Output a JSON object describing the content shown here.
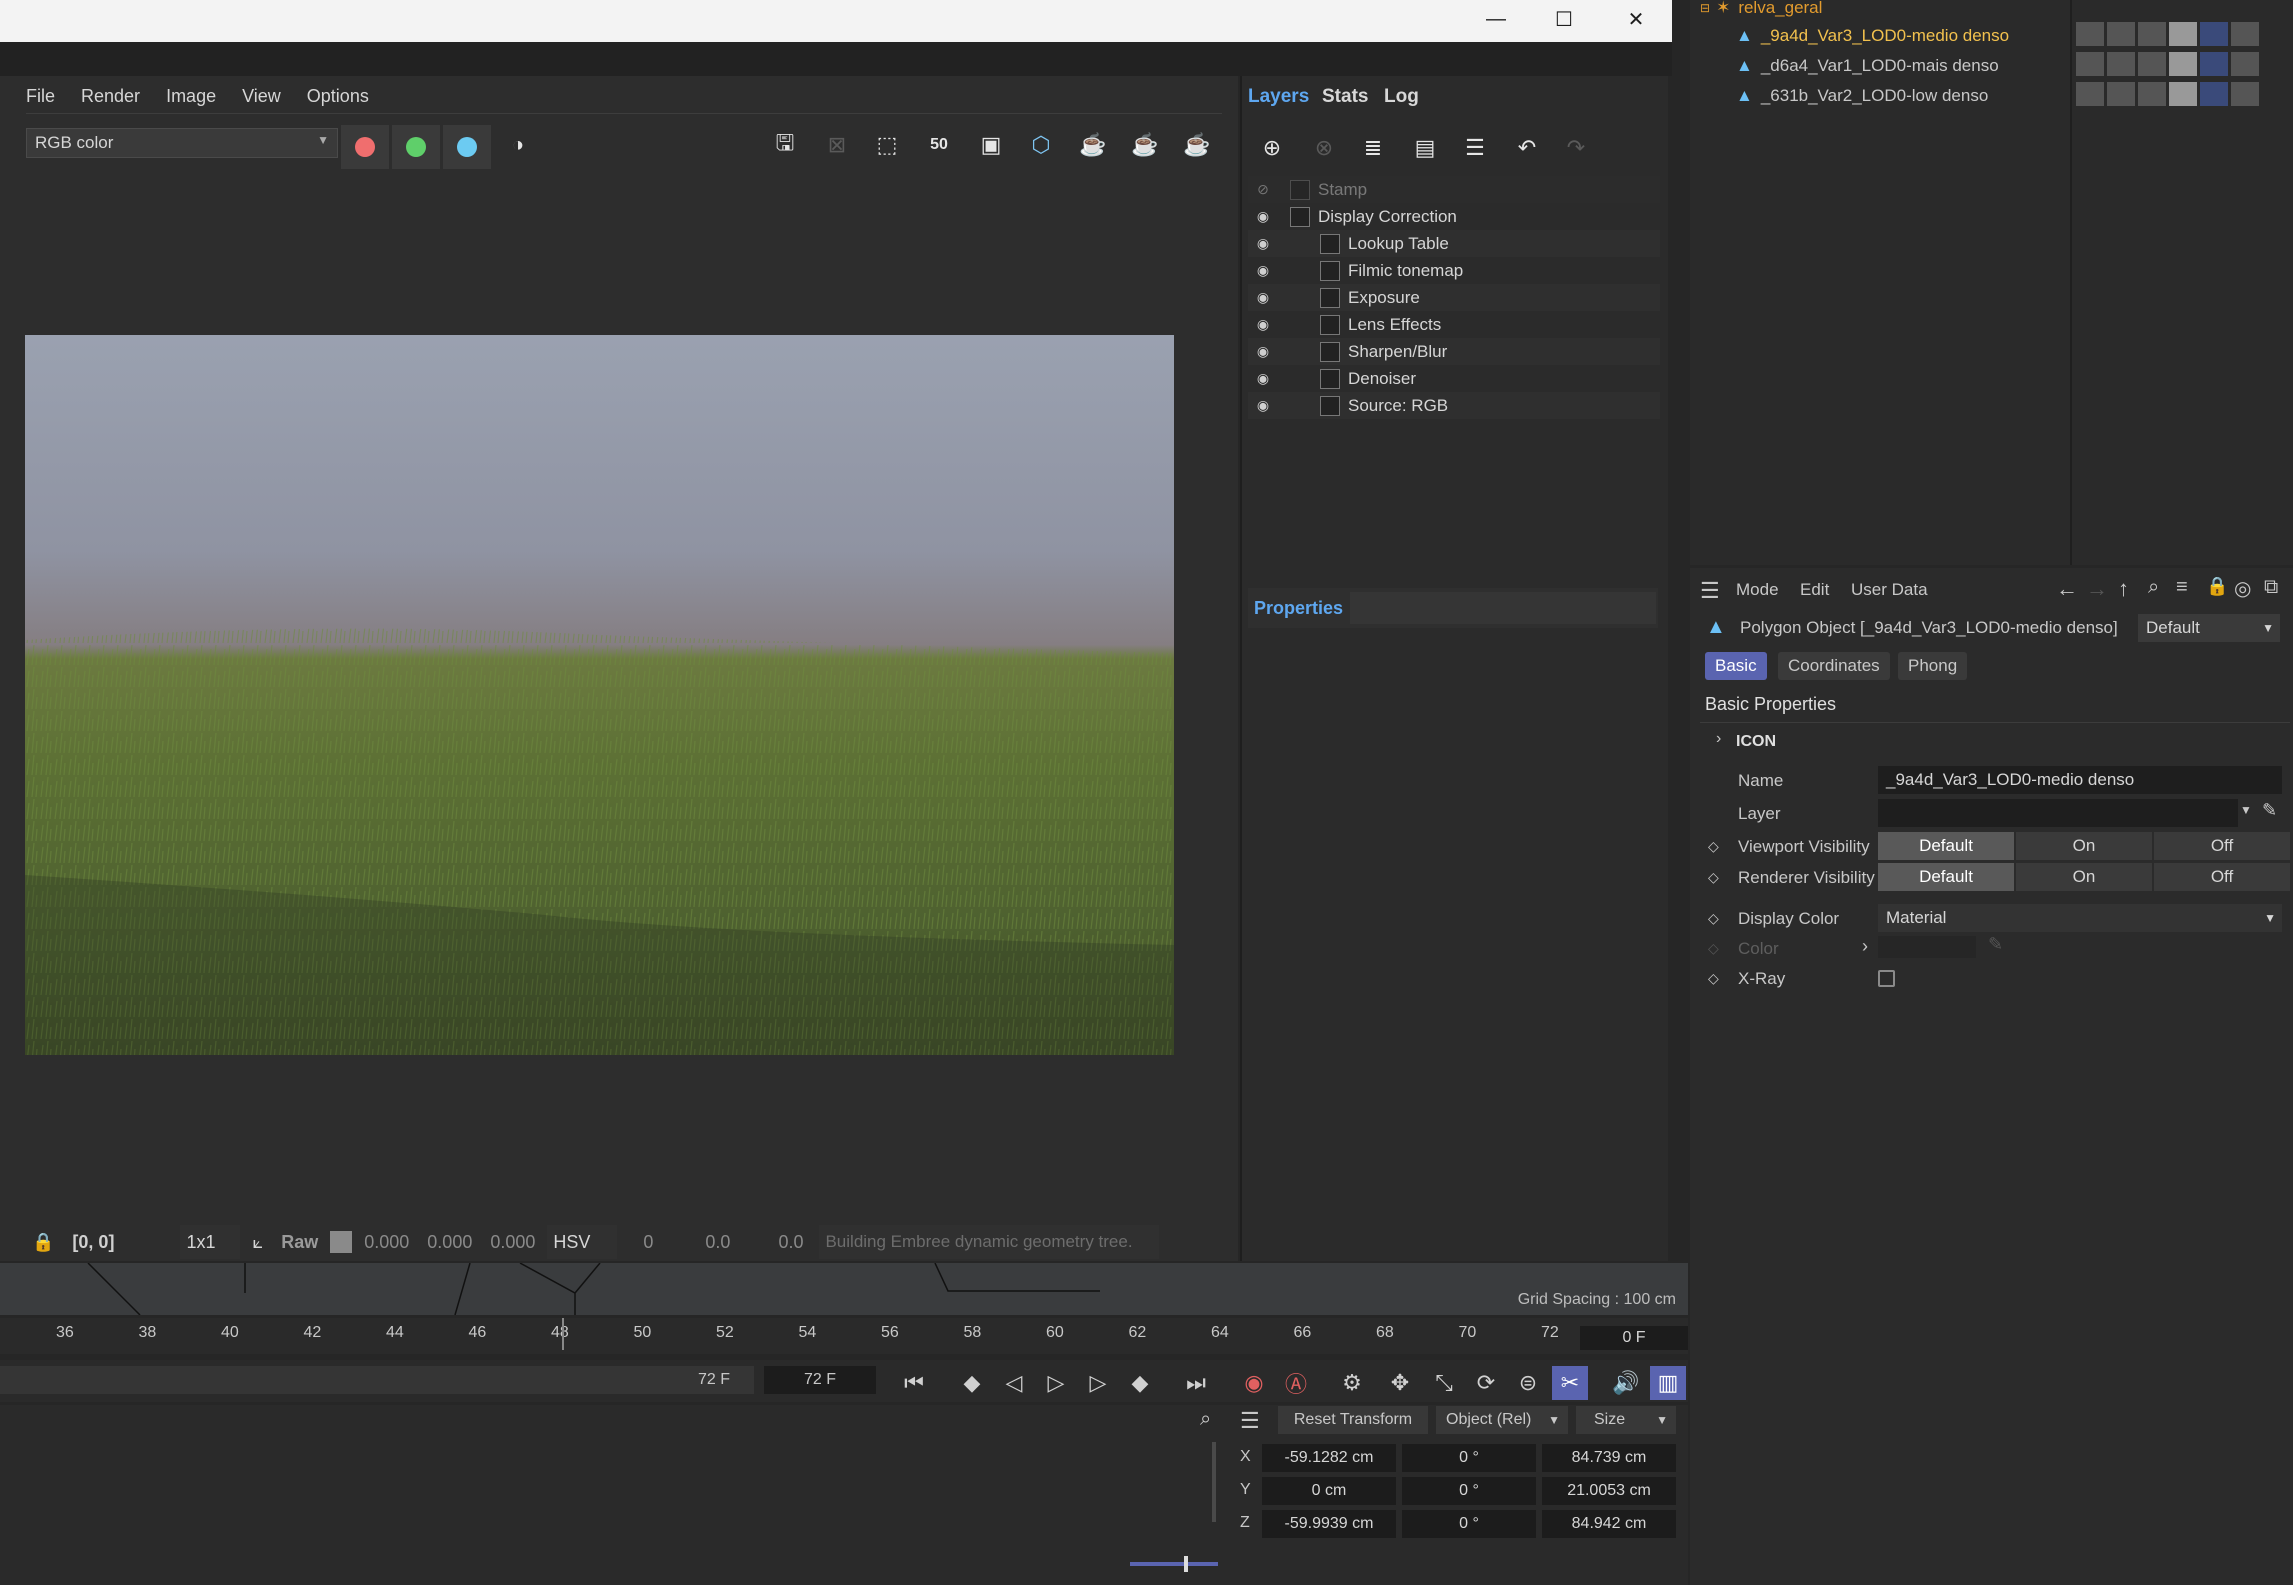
{
  "window": {
    "minimize": "—",
    "maximize": "☐",
    "close": "✕"
  },
  "menu": {
    "file": "File",
    "render": "Render",
    "image": "Image",
    "view": "View",
    "options": "Options"
  },
  "channel": {
    "value": "RGB color"
  },
  "viewer_status": {
    "coord": "[0, 0]",
    "ratio": "1x1",
    "mode": "Raw",
    "r": "0.000",
    "g": "0.000",
    "b": "0.000",
    "colorspace": "HSV",
    "h": "0",
    "s": "0.0",
    "v": "0.0",
    "message": "Building Embree dynamic geometry tree."
  },
  "panel_tabs": {
    "layers": "Layers",
    "stats": "Stats",
    "log": "Log"
  },
  "layers": [
    {
      "label": "Stamp",
      "icon": "stamp-icon",
      "dim": true,
      "indent": 0
    },
    {
      "label": "Display Correction",
      "icon": "curve-icon",
      "dim": false,
      "indent": 0
    },
    {
      "label": "Lookup Table",
      "icon": "lut-icon",
      "dim": false,
      "indent": 1
    },
    {
      "label": "Filmic tonemap",
      "icon": "tonemap-icon",
      "dim": false,
      "indent": 1
    },
    {
      "label": "Exposure",
      "icon": "exposure-icon",
      "dim": false,
      "indent": 1
    },
    {
      "label": "Lens Effects",
      "icon": "lens-icon",
      "dim": false,
      "indent": 1
    },
    {
      "label": "Sharpen/Blur",
      "icon": "sharpen-icon",
      "dim": false,
      "indent": 1
    },
    {
      "label": "Denoiser",
      "icon": "denoiser-icon",
      "dim": false,
      "indent": 1
    },
    {
      "label": "Source: RGB",
      "icon": "source-icon",
      "dim": false,
      "indent": 1
    }
  ],
  "properties": {
    "title": "Properties"
  },
  "objects": {
    "parent": "relva_geral",
    "items": [
      "_9a4d_Var3_LOD0-medio denso",
      "_d6a4_Var1_LOD0-mais denso",
      "_631b_Var2_LOD0-low denso"
    ]
  },
  "attr": {
    "menu": {
      "mode": "Mode",
      "edit": "Edit",
      "userdata": "User Data"
    },
    "title": "Polygon Object [_9a4d_Var3_LOD0-medio denso]",
    "preset": "Default",
    "tabs": {
      "basic": "Basic",
      "coordinates": "Coordinates",
      "phong": "Phong"
    },
    "section": "Basic Properties",
    "group": "ICON",
    "name_label": "Name",
    "name_value": "_9a4d_Var3_LOD0-medio denso",
    "layer_label": "Layer",
    "viewport_label": "Viewport Visibility",
    "renderer_label": "Renderer Visibility",
    "opt_default": "Default",
    "opt_on": "On",
    "opt_off": "Off",
    "displaycolor_label": "Display Color",
    "displaycolor_value": "Material",
    "color_label": "Color",
    "xray_label": "X-Ray"
  },
  "viewport": {
    "grid": "Grid Spacing : 100 cm"
  },
  "timeline": {
    "ticks": [
      "36",
      "38",
      "40",
      "42",
      "44",
      "46",
      "48",
      "50",
      "52",
      "54",
      "56",
      "58",
      "60",
      "62",
      "64",
      "66",
      "68",
      "70",
      "72"
    ],
    "current": "0 F",
    "end1": "72 F",
    "end2": "72 F"
  },
  "coords": {
    "reset": "Reset Transform",
    "mode": "Object (Rel)",
    "size": "Size",
    "rows": [
      {
        "axis": "X",
        "pos": "-59.1282 cm",
        "rot": "0 °",
        "size": "84.739 cm"
      },
      {
        "axis": "Y",
        "pos": "0 cm",
        "rot": "0 °",
        "size": "21.0053 cm"
      },
      {
        "axis": "Z",
        "pos": "-59.9939 cm",
        "rot": "0 °",
        "size": "84.942 cm"
      }
    ]
  }
}
